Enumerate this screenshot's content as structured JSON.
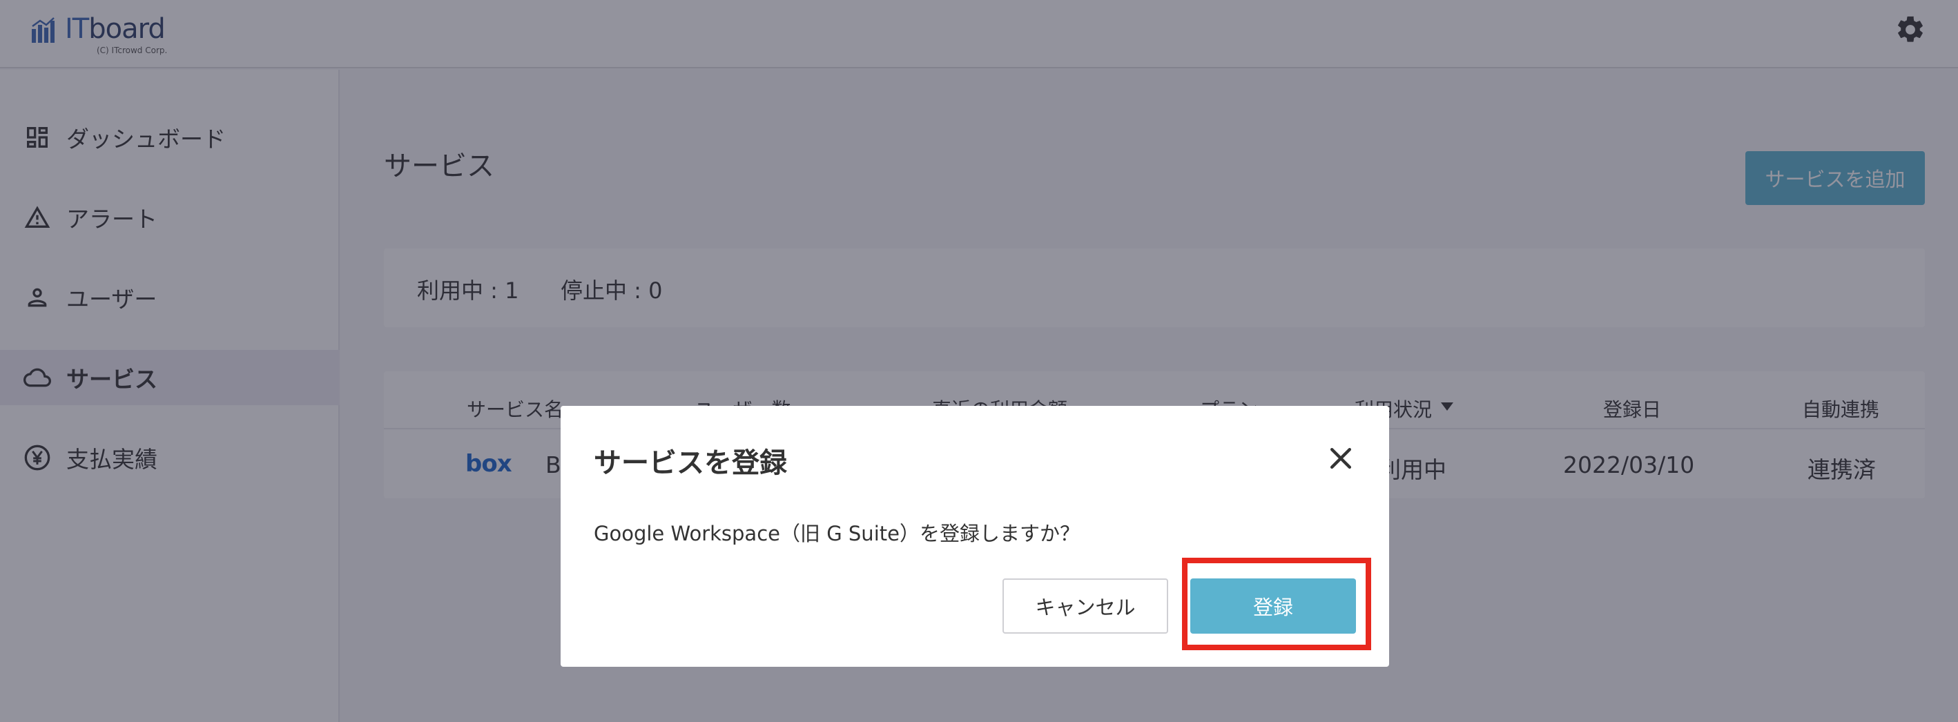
{
  "header": {
    "logo_it": "IT",
    "logo_board": "board",
    "logo_copyright": "(C) ITcrowd Corp.",
    "settings_icon": "gear-icon"
  },
  "sidebar": {
    "items": [
      {
        "label": "ダッシュボード",
        "icon": "dashboard-icon",
        "active": false
      },
      {
        "label": "アラート",
        "icon": "alert-triangle-icon",
        "active": false
      },
      {
        "label": "ユーザー",
        "icon": "user-icon",
        "active": false
      },
      {
        "label": "サービス",
        "icon": "cloud-icon",
        "active": true
      },
      {
        "label": "支払実績",
        "icon": "yen-icon",
        "active": false
      }
    ]
  },
  "main": {
    "title": "サービス",
    "add_button": "サービスを追加",
    "summary": {
      "active": "利用中 : 1",
      "stopped": "停止中 : 0"
    },
    "table": {
      "headers": {
        "name": "サービス名",
        "users": "ユーザー数",
        "amount": "直近の利用金額",
        "plan": "プラン",
        "status": "利用状況",
        "registered": "登録日",
        "auto": "自動連携"
      },
      "rows": [
        {
          "logo": "box",
          "name": "B",
          "status": "利用中",
          "registered": "2022/03/10",
          "auto": "連携済"
        }
      ]
    }
  },
  "modal": {
    "title": "サービスを登録",
    "message": "Google Workspace（旧 G Suite）を登録しますか？",
    "cancel": "キャンセル",
    "confirm": "登録"
  },
  "colors": {
    "accent": "#5bb3cf",
    "highlight": "#e8281e",
    "brand": "#2c4f8a"
  }
}
